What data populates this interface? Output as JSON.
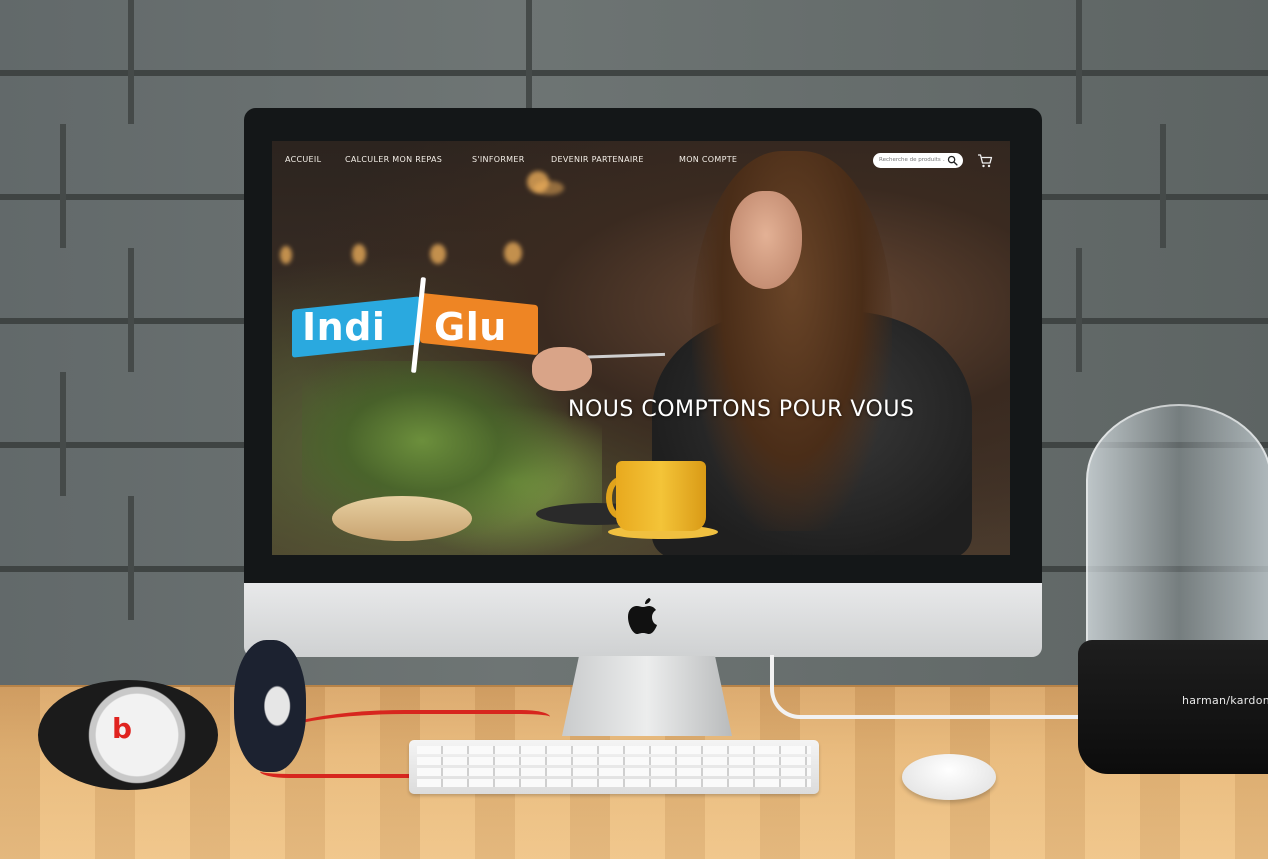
{
  "nav": {
    "items": [
      {
        "label": "ACCUEIL"
      },
      {
        "label": "CALCULER MON REPAS"
      },
      {
        "label": "S'INFORMER"
      },
      {
        "label": "DEVENIR PARTENAIRE"
      },
      {
        "label": "MON COMPTE"
      }
    ],
    "search_placeholder": "Recherche de produits ...",
    "search_icon": "search-icon",
    "cart_icon": "cart-icon"
  },
  "logo": {
    "left_text": "Indi",
    "right_text": "Glu",
    "colors": {
      "left": "#2aa9df",
      "right": "#ee8524"
    }
  },
  "hero": {
    "tagline": "NOUS COMPTONS POUR VOUS"
  },
  "desk": {
    "headphones_logo": "b",
    "speaker_brand": "harman/kardon"
  }
}
